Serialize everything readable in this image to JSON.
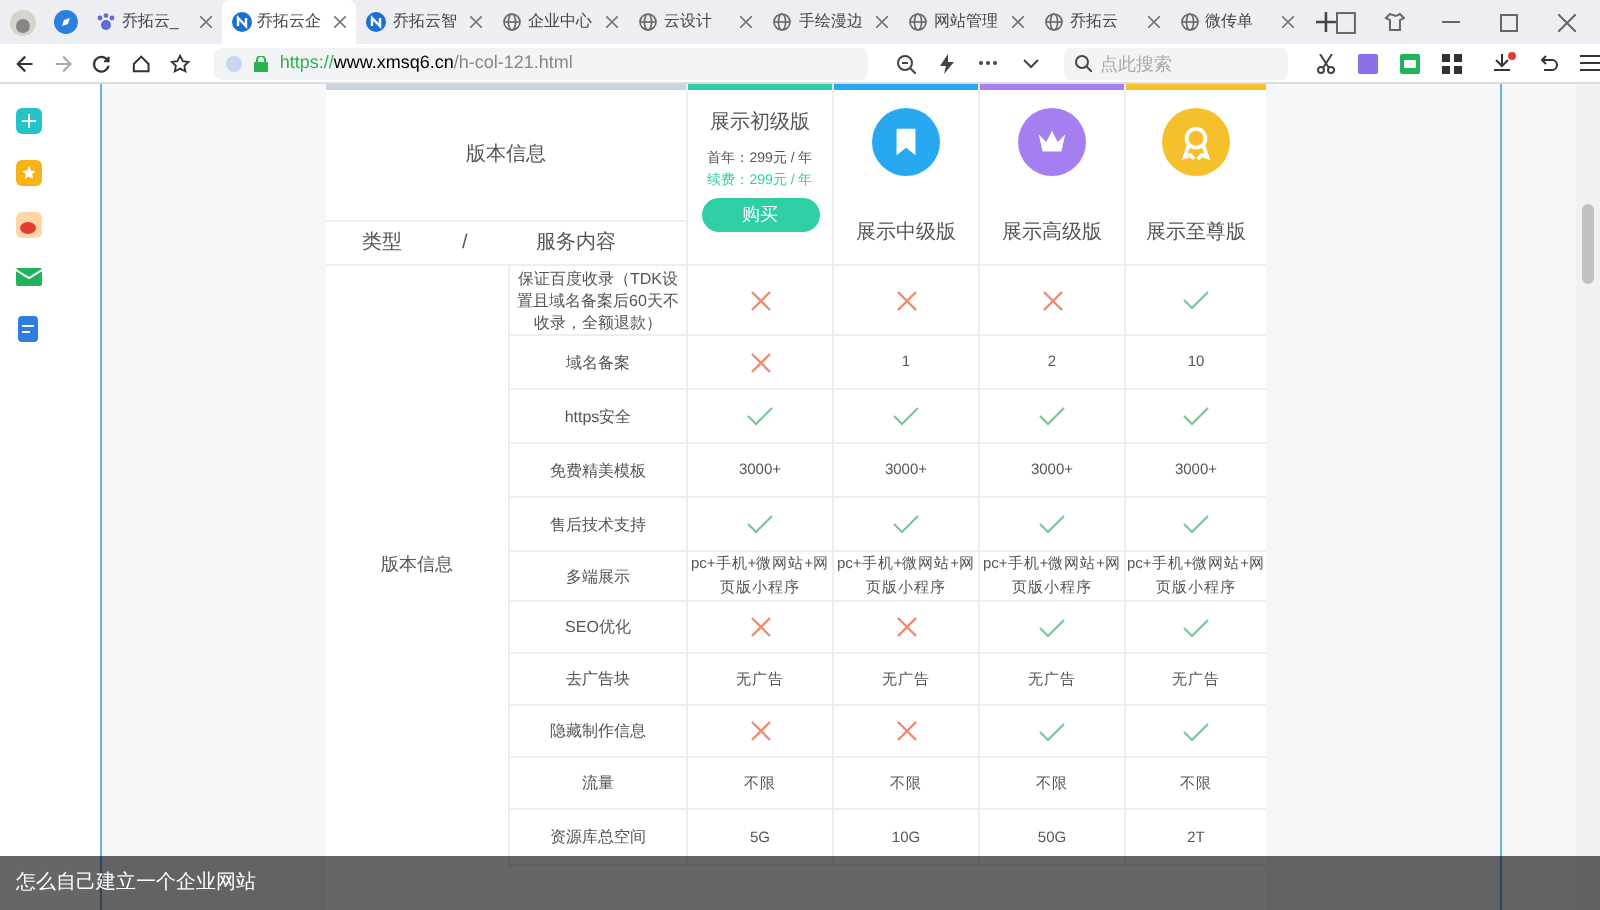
{
  "tabs": [
    {
      "label": "乔拓云_",
      "selected": false
    },
    {
      "label": "乔拓云企",
      "selected": true
    },
    {
      "label": "乔拓云智",
      "selected": false
    },
    {
      "label": "企业中心",
      "selected": false
    },
    {
      "label": "云设计",
      "selected": false
    },
    {
      "label": "手绘漫边",
      "selected": false
    },
    {
      "label": "网站管理",
      "selected": false
    },
    {
      "label": "乔拓云",
      "selected": false
    },
    {
      "label": "微传单",
      "selected": false
    }
  ],
  "address": {
    "scheme": "https://",
    "host": "www.xmsq6.cn",
    "path": "/h-col-121.html"
  },
  "search": {
    "placeholder": "点此搜索"
  },
  "header": {
    "title": "版本信息",
    "type_label": "类型",
    "slash": "/",
    "service_label": "服务内容"
  },
  "plans": [
    {
      "kind": "detailed",
      "name": "展示初级版",
      "color": "#2ecfa5",
      "price_first": "首年：299元 / 年",
      "price_renew": "续费：299元 / 年",
      "button": "购买"
    },
    {
      "kind": "icon",
      "name": "展示中级版",
      "color": "#27a8f0"
    },
    {
      "kind": "icon",
      "name": "展示高级版",
      "color": "#a57ef0"
    },
    {
      "kind": "icon",
      "name": "展示至尊版",
      "color": "#f5c02c"
    }
  ],
  "category": "版本信息",
  "rows": [
    {
      "service": "保证百度收录（TDK设置且域名备案后60天不收录，全额退款）",
      "cells": [
        {
          "kind": "cross"
        },
        {
          "kind": "cross"
        },
        {
          "kind": "cross"
        },
        {
          "kind": "check"
        }
      ]
    },
    {
      "service": "域名备案",
      "cells": [
        {
          "kind": "cross"
        },
        {
          "kind": "text",
          "text": "1"
        },
        {
          "kind": "text",
          "text": "2"
        },
        {
          "kind": "text",
          "text": "10"
        }
      ]
    },
    {
      "service": "https安全",
      "cells": [
        {
          "kind": "check"
        },
        {
          "kind": "check"
        },
        {
          "kind": "check"
        },
        {
          "kind": "check"
        }
      ]
    },
    {
      "service": "免费精美模板",
      "cells": [
        {
          "kind": "text",
          "text": "3000+"
        },
        {
          "kind": "text",
          "text": "3000+"
        },
        {
          "kind": "text",
          "text": "3000+"
        },
        {
          "kind": "text",
          "text": "3000+"
        }
      ]
    },
    {
      "service": "售后技术支持",
      "cells": [
        {
          "kind": "check"
        },
        {
          "kind": "check"
        },
        {
          "kind": "check"
        },
        {
          "kind": "check"
        }
      ]
    },
    {
      "service": "多端展示",
      "cells": [
        {
          "kind": "text",
          "text": "pc+手机+微网站+网页版小程序"
        },
        {
          "kind": "text",
          "text": "pc+手机+微网站+网页版小程序"
        },
        {
          "kind": "text",
          "text": "pc+手机+微网站+网页版小程序"
        },
        {
          "kind": "text",
          "text": "pc+手机+微网站+网页版小程序"
        }
      ]
    },
    {
      "service": "SEO优化",
      "cells": [
        {
          "kind": "cross"
        },
        {
          "kind": "cross"
        },
        {
          "kind": "check"
        },
        {
          "kind": "check"
        }
      ]
    },
    {
      "service": "去广告块",
      "cells": [
        {
          "kind": "text",
          "text": "无广告"
        },
        {
          "kind": "text",
          "text": "无广告"
        },
        {
          "kind": "text",
          "text": "无广告"
        },
        {
          "kind": "text",
          "text": "无广告"
        }
      ]
    },
    {
      "service": "隐藏制作信息",
      "cells": [
        {
          "kind": "cross"
        },
        {
          "kind": "cross"
        },
        {
          "kind": "check"
        },
        {
          "kind": "check"
        }
      ]
    },
    {
      "service": "流量",
      "cells": [
        {
          "kind": "text",
          "text": "不限"
        },
        {
          "kind": "text",
          "text": "不限"
        },
        {
          "kind": "text",
          "text": "不限"
        },
        {
          "kind": "text",
          "text": "不限"
        }
      ]
    },
    {
      "service": "资源库总空间",
      "cells": [
        {
          "kind": "text",
          "text": "5G"
        },
        {
          "kind": "text",
          "text": "10G"
        },
        {
          "kind": "text",
          "text": "50G"
        },
        {
          "kind": "text",
          "text": "2T"
        }
      ]
    }
  ],
  "caption": "怎么自己建立一个企业网站"
}
